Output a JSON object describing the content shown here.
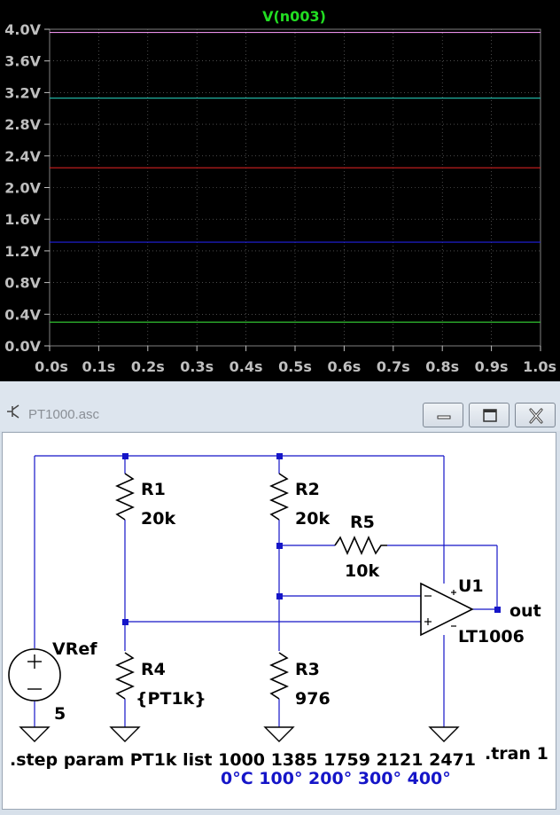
{
  "plot": {
    "trace_label": "V(n003)",
    "y_ticks": [
      "4.0V",
      "3.6V",
      "3.2V",
      "2.8V",
      "2.4V",
      "2.0V",
      "1.6V",
      "1.2V",
      "0.8V",
      "0.4V",
      "0.0V"
    ],
    "x_ticks": [
      "0.0s",
      "0.1s",
      "0.2s",
      "0.3s",
      "0.4s",
      "0.5s",
      "0.6s",
      "0.7s",
      "0.8s",
      "0.9s",
      "1.0s"
    ],
    "traces": [
      {
        "value": 3.96,
        "color": "#e890e8"
      },
      {
        "value": 3.13,
        "color": "#20b0a0"
      },
      {
        "value": 2.25,
        "color": "#d02020"
      },
      {
        "value": 1.31,
        "color": "#2020e0"
      },
      {
        "value": 0.3,
        "color": "#30c030"
      }
    ],
    "ylim": [
      0.0,
      4.0
    ],
    "xlim": [
      0.0,
      1.0
    ]
  },
  "window": {
    "title": "PT1000.asc",
    "buttons": {
      "minimize": "minimize",
      "maximize": "maximize",
      "close": "close"
    }
  },
  "schematic": {
    "r1": {
      "name": "R1",
      "value": "20k"
    },
    "r2": {
      "name": "R2",
      "value": "20k"
    },
    "r5": {
      "name": "R5",
      "value": "10k"
    },
    "r4": {
      "name": "R4",
      "value": "{PT1k}"
    },
    "r3": {
      "name": "R3",
      "value": "976"
    },
    "u1": {
      "name": "U1",
      "model": "LT1006"
    },
    "vref": {
      "name": "VRef",
      "value": "5"
    },
    "out_label": "out",
    "step_directive": ".step param PT1k list 1000 1385 1759 2121 2471",
    "temps_comment": "0°C 100° 200° 300° 400°",
    "tran_directive": ".tran 1"
  }
}
